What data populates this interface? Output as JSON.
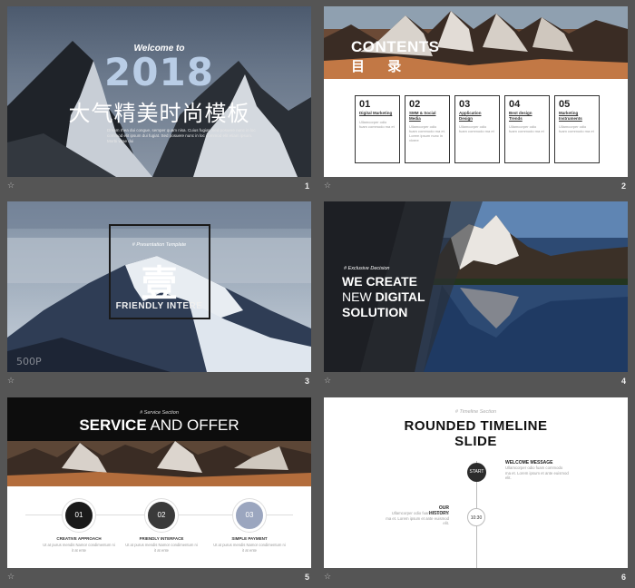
{
  "slides": [
    {
      "number": "1",
      "welcome": "Welcome to",
      "year": "2018",
      "title_cn": "大气精美时尚模板",
      "description": "Dream rhea dui congue, semper quam nisa. Cuius fugiat. Sed posuere nunc in loc commod elit ipsum dui fugiat. Sed posuere nunc in loc commod elit etiam ipsum. Morbi vitae dui"
    },
    {
      "number": "2",
      "contents_title": "CONTENTS",
      "contents_cn": "目 录",
      "items": [
        {
          "num": "01",
          "title": "Digital Marketing",
          "desc": "Ullamcorper odio fuam commodo ma et"
        },
        {
          "num": "02",
          "title": "SMM & Social Media",
          "desc": "Ullamcorper odio fuam commodo ma et. Lorem ipsum nunc in vivere"
        },
        {
          "num": "03",
          "title": "Application Design",
          "desc": "Ullamcorper odio fuam commodo ma et"
        },
        {
          "num": "04",
          "title": "Best design Trends",
          "desc": "Ullamcorper odio fuam commodo ma et"
        },
        {
          "num": "05",
          "title": "Marketing Instruments",
          "desc": "Ullamcorper odio fuam commodo ma et"
        }
      ]
    },
    {
      "number": "3",
      "tag": "# Presentation Template",
      "char": "壹",
      "subtitle": "FRIENDLY INTERE",
      "watermark": "500P"
    },
    {
      "number": "4",
      "tag": "# Exclusive Decision",
      "line1": "WE CREATE",
      "line2a": "NEW ",
      "line2b": "DIGITAL",
      "line3": "SOLUTION"
    },
    {
      "number": "5",
      "tag": "# Service Section",
      "title_bold": "SERVICE",
      "title_rest": " AND OFFER",
      "circles": [
        {
          "num": "01",
          "title": "CREATIVE APPROACH",
          "desc": "Ut at purus mendis Namor condimentum ni it at ente",
          "color": "#1a1a1a"
        },
        {
          "num": "02",
          "title": "FRIENDLY INTERFACE",
          "desc": "Ut at purus mendis Namor condimentum ni it at ente",
          "color": "#3a3a3a"
        },
        {
          "num": "03",
          "title": "SIMPLE PAYMENT",
          "desc": "Ut at purus mendis Namor condimentum ni it at ente",
          "color": "#9ba6bf"
        }
      ]
    },
    {
      "number": "6",
      "tag": "# Timeline Section",
      "title1": "ROUNDED TIMELINE",
      "title2": "SLIDE",
      "start_label": "START",
      "time_label": "10:30",
      "welcome_title": "WELCOME MESSAGE",
      "welcome_desc": "Ullamcorper odio fuam commodo ma et. Lorem ipsum et ante euismod elit.",
      "history_title": "OUR HISTORY",
      "history_desc": "Ullamcorper odio fuam commodo ma et. Lorem ipsum et ante euismod elit."
    }
  ],
  "star_icon": "☆"
}
